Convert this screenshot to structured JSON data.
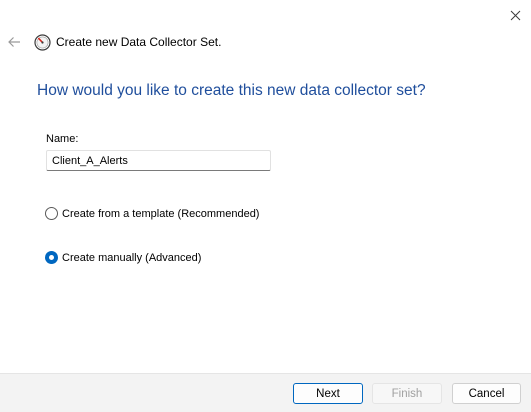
{
  "window": {
    "close_icon": "close-icon",
    "back_icon": "back-arrow-icon",
    "app_icon": "performance-monitor-icon"
  },
  "wizard": {
    "title": "Create new Data Collector Set.",
    "heading": "How would you like to create this new data collector set?"
  },
  "form": {
    "name_label": "Name:",
    "name_value": "Client_A_Alerts",
    "options": [
      {
        "label": "Create from a template (Recommended)",
        "selected": false
      },
      {
        "label": "Create manually (Advanced)",
        "selected": true
      }
    ]
  },
  "footer": {
    "next_label": "Next",
    "finish_label": "Finish",
    "cancel_label": "Cancel"
  },
  "colors": {
    "heading": "#1f4e9c",
    "accent": "#0067c0",
    "footer_bg": "#f3f3f3"
  }
}
